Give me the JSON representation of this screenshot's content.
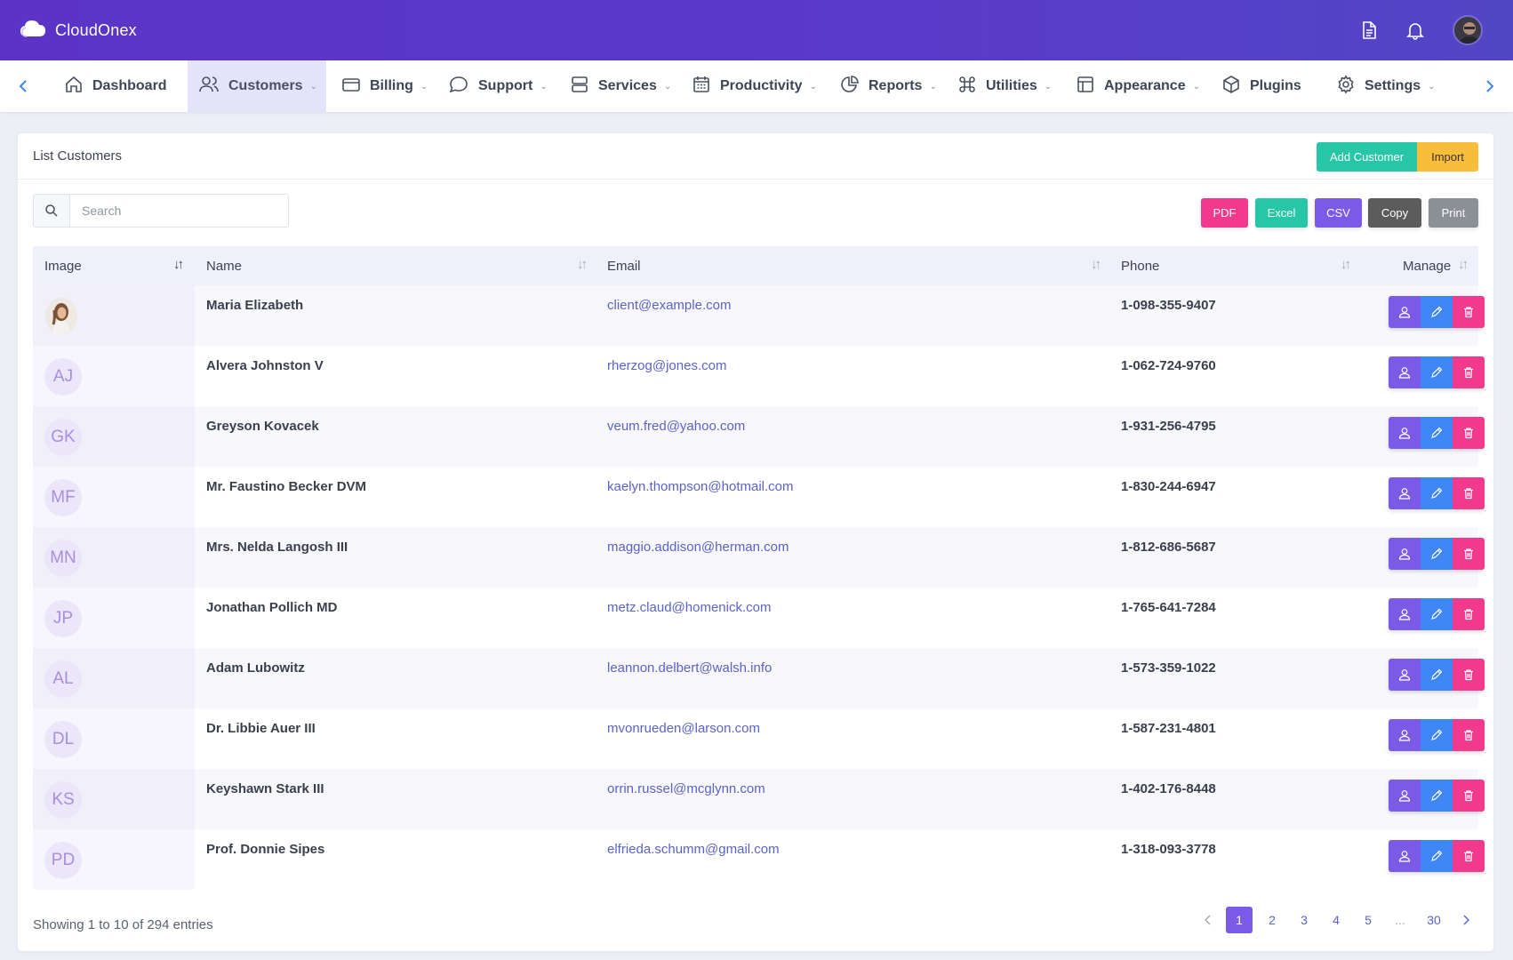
{
  "app": {
    "name": "CloudOnex"
  },
  "nav": {
    "items": [
      {
        "label": "Dashboard",
        "icon": "home-icon"
      },
      {
        "label": "Customers",
        "icon": "users-icon",
        "active": true
      },
      {
        "label": "Billing",
        "icon": "credit-card-icon"
      },
      {
        "label": "Support",
        "icon": "chat-icon"
      },
      {
        "label": "Services",
        "icon": "server-icon"
      },
      {
        "label": "Productivity",
        "icon": "calendar-icon"
      },
      {
        "label": "Reports",
        "icon": "pie-chart-icon"
      },
      {
        "label": "Utilities",
        "icon": "command-icon"
      },
      {
        "label": "Appearance",
        "icon": "layout-icon"
      },
      {
        "label": "Plugins",
        "icon": "package-icon"
      },
      {
        "label": "Settings",
        "icon": "gear-icon"
      }
    ]
  },
  "card": {
    "title": "List Customers",
    "add_label": "Add Customer",
    "import_label": "Import"
  },
  "search": {
    "placeholder": "Search"
  },
  "export": {
    "pdf": "PDF",
    "excel": "Excel",
    "csv": "CSV",
    "copy": "Copy",
    "print": "Print"
  },
  "table": {
    "headers": {
      "image": "Image",
      "name": "Name",
      "email": "Email",
      "phone": "Phone",
      "manage": "Manage"
    },
    "rows": [
      {
        "initials": "",
        "name": "Maria Elizabeth",
        "email": "client@example.com",
        "phone": "1-098-355-9407"
      },
      {
        "initials": "AJ",
        "name": "Alvera Johnston V",
        "email": "rherzog@jones.com",
        "phone": "1-062-724-9760"
      },
      {
        "initials": "GK",
        "name": "Greyson Kovacek",
        "email": "veum.fred@yahoo.com",
        "phone": "1-931-256-4795"
      },
      {
        "initials": "MF",
        "name": "Mr. Faustino Becker DVM",
        "email": "kaelyn.thompson@hotmail.com",
        "phone": "1-830-244-6947"
      },
      {
        "initials": "MN",
        "name": "Mrs. Nelda Langosh III",
        "email": "maggio.addison@herman.com",
        "phone": "1-812-686-5687"
      },
      {
        "initials": "JP",
        "name": "Jonathan Pollich MD",
        "email": "metz.claud@homenick.com",
        "phone": "1-765-641-7284"
      },
      {
        "initials": "AL",
        "name": "Adam Lubowitz",
        "email": "leannon.delbert@walsh.info",
        "phone": "1-573-359-1022"
      },
      {
        "initials": "DL",
        "name": "Dr. Libbie Auer III",
        "email": "mvonrueden@larson.com",
        "phone": "1-587-231-4801"
      },
      {
        "initials": "KS",
        "name": "Keyshawn Stark III",
        "email": "orrin.russel@mcglynn.com",
        "phone": "1-402-176-8448"
      },
      {
        "initials": "PD",
        "name": "Prof. Donnie Sipes",
        "email": "elfrieda.schumm@gmail.com",
        "phone": "1-318-093-3778"
      }
    ]
  },
  "footer": {
    "showing": "Showing 1 to 10 of 294 entries",
    "pages": [
      "1",
      "2",
      "3",
      "4",
      "5",
      "...",
      "30"
    ],
    "current_page": "1"
  },
  "colors": {
    "header_bg": "#5b34c6",
    "accent": "#7a5ae6",
    "add_customer": "#27c6a7",
    "import": "#f9bd3c",
    "pdf": "#f23a8d",
    "excel": "#27c6a7",
    "csv": "#7a5ae6",
    "copy": "#5c5c5c",
    "print": "#8b9097",
    "view_btn": "#7a5ae6",
    "edit_btn": "#3f86f6",
    "delete_btn": "#f23a8d"
  }
}
